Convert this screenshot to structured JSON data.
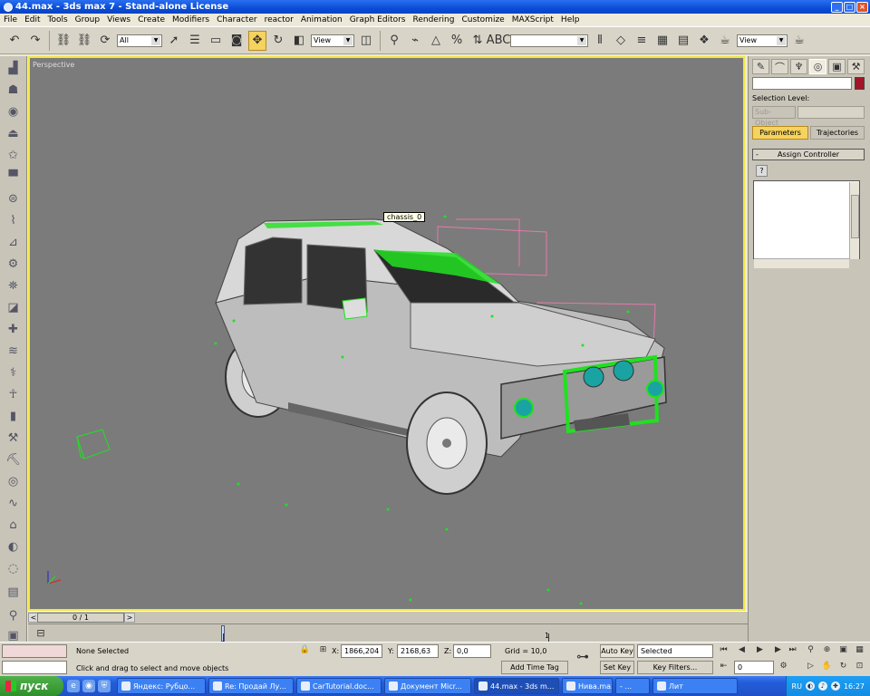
{
  "window": {
    "title": "44.max - 3ds max 7   - Stand-alone License"
  },
  "menu": [
    "File",
    "Edit",
    "Tools",
    "Group",
    "Views",
    "Create",
    "Modifiers",
    "Character",
    "reactor",
    "Animation",
    "Graph Editors",
    "Rendering",
    "Customize",
    "MAXScript",
    "Help"
  ],
  "toolbar": {
    "selection_filter": "All",
    "ref_coord": "View",
    "named_selection": "",
    "render_view": "View"
  },
  "viewport": {
    "label": "Perspective",
    "object_tag": "chassis_0"
  },
  "command_panel": {
    "selection_level_label": "Selection Level:",
    "sub_object_label": "Sub-Object",
    "tab_parameters": "Parameters",
    "tab_trajectories": "Trajectories",
    "rollout_minus": "-",
    "rollout_title": "Assign Controller"
  },
  "timeline": {
    "frame_display": "0 / 1",
    "prev_arrow": "<",
    "next_arrow": ">",
    "track_value": "1"
  },
  "status": {
    "selection": "None Selected",
    "prompt": "Click and drag to select and move objects",
    "x_label": "X:",
    "x_value": "1866,204",
    "y_label": "Y:",
    "y_value": "2168,63",
    "z_label": "Z:",
    "z_value": "0,0",
    "grid": "Grid = 10,0",
    "add_time_tag": "Add Time Tag",
    "auto_key": "Auto Key",
    "set_key": "Set Key",
    "key_mode": "Selected",
    "key_filters": "Key Filters...",
    "frame": "0"
  },
  "taskbar": {
    "start_label": "пуск",
    "tasks": [
      {
        "label": "Яндекс: Рубцо...",
        "active": false
      },
      {
        "label": "Re: Продай Лу...",
        "active": false
      },
      {
        "label": "CarTutorial.doc...",
        "active": false
      },
      {
        "label": "Документ Micr...",
        "active": false
      },
      {
        "label": "44.max - 3ds m...",
        "active": true
      },
      {
        "label": "Нива.max",
        "active": false
      },
      {
        "label": "- ...",
        "active": false
      },
      {
        "label": "Лит",
        "active": false
      }
    ],
    "lang": "RU",
    "clock": "16:27"
  },
  "colors": {
    "viewport_bg": "#7b7b7b",
    "active_border": "#f1e73e",
    "wireframe_pink": "#e67aa8",
    "selection_green": "#21e021",
    "object_color": "#a01628"
  }
}
